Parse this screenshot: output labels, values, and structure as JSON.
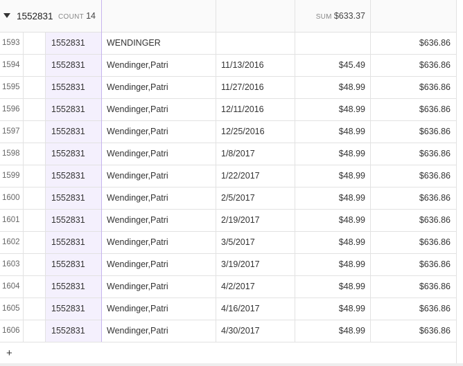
{
  "group_header": {
    "caret_icon": "caret-down-icon",
    "group_id": "1552831",
    "count_label": "COUNT",
    "count_value": "14",
    "sum_label": "SUM",
    "sum_value": "$633.37"
  },
  "rows": [
    {
      "num": "1593",
      "id": "1552831",
      "name": "WENDINGER",
      "date": "",
      "amount": "",
      "total": "$636.86"
    },
    {
      "num": "1594",
      "id": "1552831",
      "name": "Wendinger,Patri",
      "date": "11/13/2016",
      "amount": "$45.49",
      "total": "$636.86"
    },
    {
      "num": "1595",
      "id": "1552831",
      "name": "Wendinger,Patri",
      "date": "11/27/2016",
      "amount": "$48.99",
      "total": "$636.86"
    },
    {
      "num": "1596",
      "id": "1552831",
      "name": "Wendinger,Patri",
      "date": "12/11/2016",
      "amount": "$48.99",
      "total": "$636.86"
    },
    {
      "num": "1597",
      "id": "1552831",
      "name": "Wendinger,Patri",
      "date": "12/25/2016",
      "amount": "$48.99",
      "total": "$636.86"
    },
    {
      "num": "1598",
      "id": "1552831",
      "name": "Wendinger,Patri",
      "date": "1/8/2017",
      "amount": "$48.99",
      "total": "$636.86"
    },
    {
      "num": "1599",
      "id": "1552831",
      "name": "Wendinger,Patri",
      "date": "1/22/2017",
      "amount": "$48.99",
      "total": "$636.86"
    },
    {
      "num": "1600",
      "id": "1552831",
      "name": "Wendinger,Patri",
      "date": "2/5/2017",
      "amount": "$48.99",
      "total": "$636.86"
    },
    {
      "num": "1601",
      "id": "1552831",
      "name": "Wendinger,Patri",
      "date": "2/19/2017",
      "amount": "$48.99",
      "total": "$636.86"
    },
    {
      "num": "1602",
      "id": "1552831",
      "name": "Wendinger,Patri",
      "date": "3/5/2017",
      "amount": "$48.99",
      "total": "$636.86"
    },
    {
      "num": "1603",
      "id": "1552831",
      "name": "Wendinger,Patri",
      "date": "3/19/2017",
      "amount": "$48.99",
      "total": "$636.86"
    },
    {
      "num": "1604",
      "id": "1552831",
      "name": "Wendinger,Patri",
      "date": "4/2/2017",
      "amount": "$48.99",
      "total": "$636.86"
    },
    {
      "num": "1605",
      "id": "1552831",
      "name": "Wendinger,Patri",
      "date": "4/16/2017",
      "amount": "$48.99",
      "total": "$636.86"
    },
    {
      "num": "1606",
      "id": "1552831",
      "name": "Wendinger,Patri",
      "date": "4/30/2017",
      "amount": "$48.99",
      "total": "$636.86"
    }
  ],
  "footer": {
    "add_label": "+",
    "add_icon": "plus-icon"
  },
  "colors": {
    "selected_column_bg": "#f4f0fd",
    "selected_column_border": "#c7b4ee",
    "grid_line": "#e2e2e2"
  }
}
